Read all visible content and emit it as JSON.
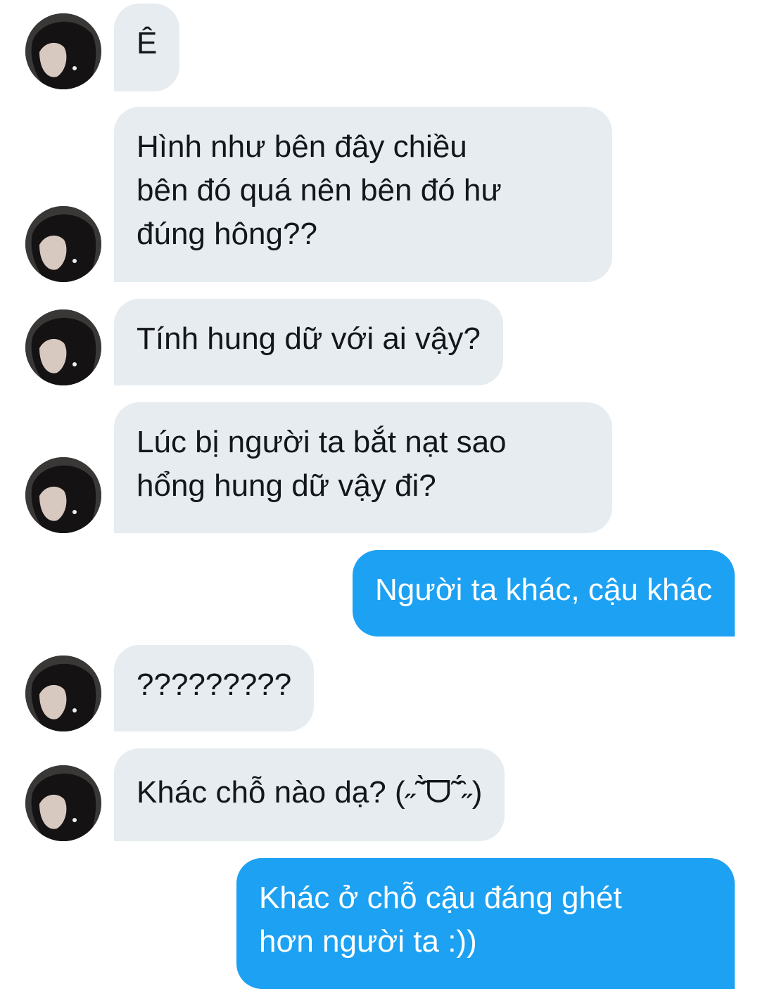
{
  "conversation": {
    "colors": {
      "incoming_bubble": "#e6ecf0",
      "incoming_text": "#14171a",
      "outgoing_bubble": "#1da1f2",
      "outgoing_text": "#ffffff"
    },
    "messages": [
      {
        "direction": "incoming",
        "text": "Ê"
      },
      {
        "direction": "incoming",
        "text": "Hình như bên đây chiều\nbên đó quá nên bên đó hư\nđúng hông??"
      },
      {
        "direction": "incoming",
        "text": "Tính hung dữ với ai vậy?"
      },
      {
        "direction": "incoming",
        "text": "Lúc bị người ta bắt nạt sao\nhổng hung dữ vậy đi?"
      },
      {
        "direction": "outgoing",
        "text": "Người ta khác, cậu khác"
      },
      {
        "direction": "incoming",
        "text": "?????????"
      },
      {
        "direction": "incoming",
        "text": "Khác chỗ nào dạ? (˶˜̑̀ᗜ˜̑́˶)"
      },
      {
        "direction": "outgoing",
        "text": "Khác ở chỗ cậu đáng ghét\nhơn người ta :))"
      }
    ]
  }
}
